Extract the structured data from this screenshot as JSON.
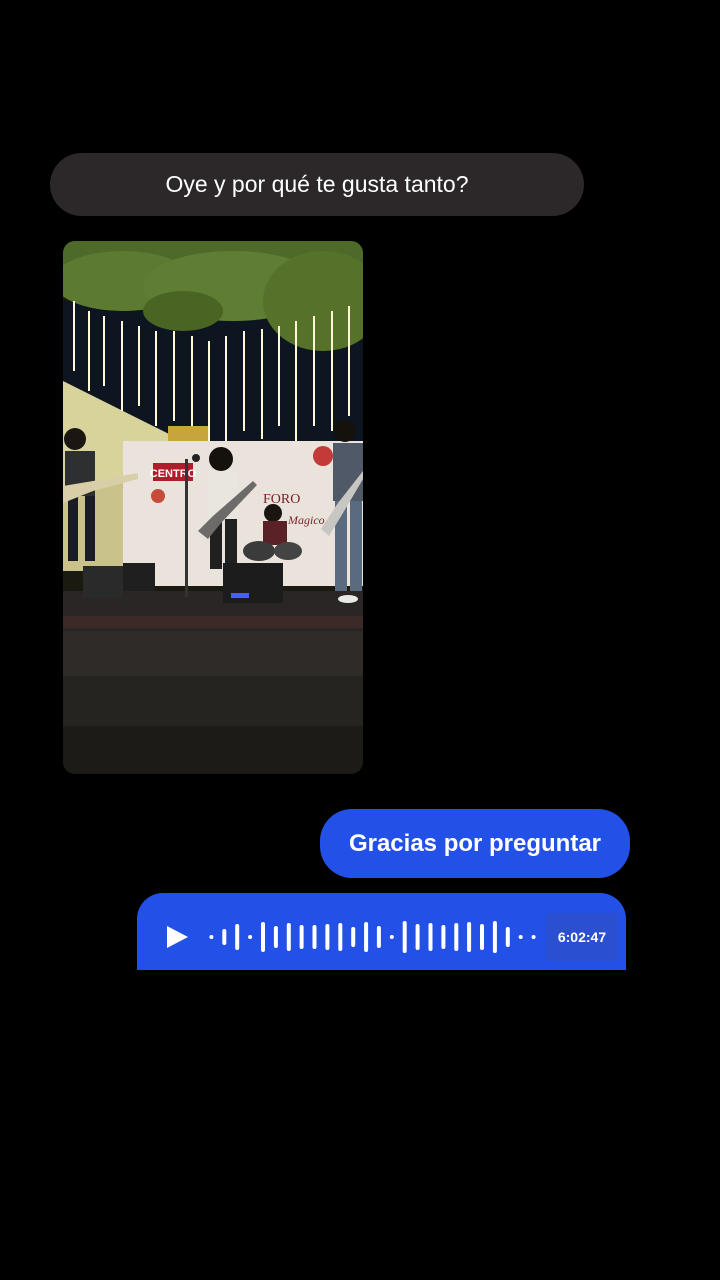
{
  "messages": {
    "incoming_text": "Oye y por qué te gusta tanto?",
    "photo_signs": {
      "centro": "CENTRO",
      "foro": "FORO",
      "magic": "Magico"
    },
    "outgoing_text": "Gracias por preguntar",
    "voice": {
      "duration": "6:02:47"
    }
  },
  "colors": {
    "incoming_bubble": "#2c2728",
    "outgoing_bubble": "#2351e8",
    "background": "#000000"
  }
}
